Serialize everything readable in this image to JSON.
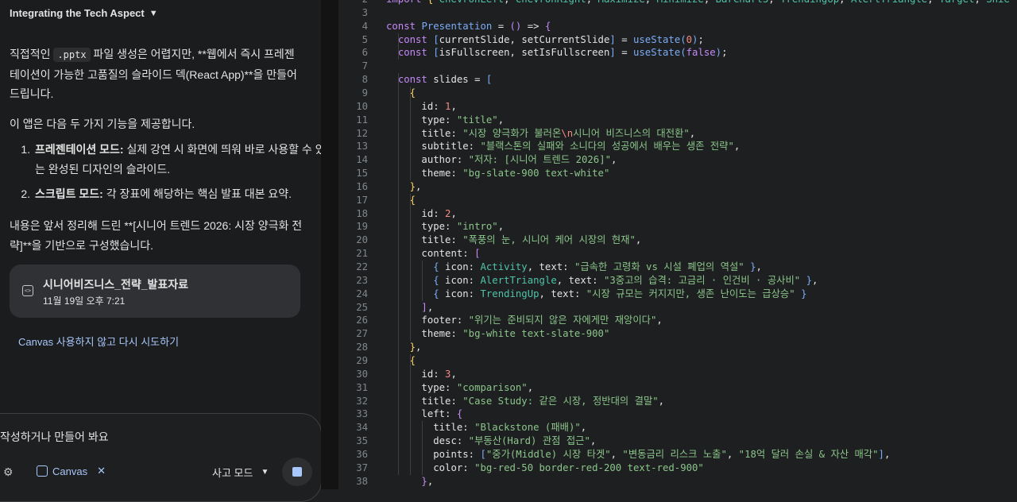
{
  "header": {
    "title": "Integrating the Tech Aspect"
  },
  "chat": {
    "intro_prefix": "직접적인 ",
    "intro_code": ".pptx",
    "intro_suffix": " 파일 생성은 어렵지만, **웹에서 즉시 프레젠테이션이 가능한 고품질의 슬라이드 덱(React App)**을 만들어 드립니다.",
    "features_intro": "이 앱은 다음 두 가지 기능을 제공합니다.",
    "features": [
      {
        "term": "프레젠테이션 모드:",
        "desc": " 실제 강연 시 화면에 띄워 바로 사용할 수 있는 완성된 디자인의 슬라이드."
      },
      {
        "term": "스크립트 모드:",
        "desc": " 각 장표에 해당하는 핵심 발표 대본 요약."
      }
    ],
    "basis": "내용은 앞서 정리해 드린 **[시니어 트렌드 2026: 시장 양극화 전략]**을 기반으로 구성했습니다.",
    "card": {
      "title": "시니어비즈니스_전략_발표자료",
      "date": "11월 19일 오후 7:21"
    },
    "retry_link": "Canvas 사용하지 않고 다시 시도하기"
  },
  "input": {
    "placeholder": "작성하거나 만들어 봐요",
    "canvas_chip": "Canvas",
    "mode": "사고 모드"
  },
  "code": {
    "lines": [
      {
        "n": 2,
        "t": "import { ChevronLeft, ChevronRight, Maximize, Minimize, BarChart3, TrendingUp, AlertTriangle, Target, Shie"
      },
      {
        "n": 3,
        "t": ""
      },
      {
        "n": 4,
        "t": "const Presentation = () => {"
      },
      {
        "n": 5,
        "t": "  const [currentSlide, setCurrentSlide] = useState(0);"
      },
      {
        "n": 6,
        "t": "  const [isFullscreen, setIsFullscreen] = useState(false);"
      },
      {
        "n": 7,
        "t": ""
      },
      {
        "n": 8,
        "t": "  const slides = ["
      },
      {
        "n": 9,
        "t": "    {"
      },
      {
        "n": 10,
        "t": "      id: 1,"
      },
      {
        "n": 11,
        "t": "      type: \"title\","
      },
      {
        "n": 12,
        "t": "      title: \"시장 양극화가 불러온\\n시니어 비즈니스의 대전환\","
      },
      {
        "n": 13,
        "t": "      subtitle: \"블랙스톤의 실패와 소니다의 성공에서 배우는 생존 전략\","
      },
      {
        "n": 14,
        "t": "      author: \"저자: [시니어 트렌드 2026]\","
      },
      {
        "n": 15,
        "t": "      theme: \"bg-slate-900 text-white\""
      },
      {
        "n": 16,
        "t": "    },"
      },
      {
        "n": 17,
        "t": "    {"
      },
      {
        "n": 18,
        "t": "      id: 2,"
      },
      {
        "n": 19,
        "t": "      type: \"intro\","
      },
      {
        "n": 20,
        "t": "      title: \"폭풍의 눈, 시니어 케어 시장의 현재\","
      },
      {
        "n": 21,
        "t": "      content: ["
      },
      {
        "n": 22,
        "t": "        { icon: Activity, text: \"급속한 고령화 vs 시설 폐업의 역설\" },"
      },
      {
        "n": 23,
        "t": "        { icon: AlertTriangle, text: \"3중고의 습격: 고금리 · 인건비 · 공사비\" },"
      },
      {
        "n": 24,
        "t": "        { icon: TrendingUp, text: \"시장 규모는 커지지만, 생존 난이도는 급상승\" }"
      },
      {
        "n": 25,
        "t": "      ],"
      },
      {
        "n": 26,
        "t": "      footer: \"위기는 준비되지 않은 자에게만 재앙이다\","
      },
      {
        "n": 27,
        "t": "      theme: \"bg-white text-slate-900\""
      },
      {
        "n": 28,
        "t": "    },"
      },
      {
        "n": 29,
        "t": "    {"
      },
      {
        "n": 30,
        "t": "      id: 3,"
      },
      {
        "n": 31,
        "t": "      type: \"comparison\","
      },
      {
        "n": 32,
        "t": "      title: \"Case Study: 같은 시장, 정반대의 결말\","
      },
      {
        "n": 33,
        "t": "      left: {"
      },
      {
        "n": 34,
        "t": "        title: \"Blackstone (패배)\","
      },
      {
        "n": 35,
        "t": "        desc: \"부동산(Hard) 관점 접근\","
      },
      {
        "n": 36,
        "t": "        points: [\"중가(Middle) 시장 타겟\", \"변동금리 리스크 노출\", \"18억 달러 손실 & 자산 매각\"],"
      },
      {
        "n": 37,
        "t": "        color: \"bg-red-50 border-red-200 text-red-900\""
      },
      {
        "n": 38,
        "t": "      },"
      }
    ]
  }
}
